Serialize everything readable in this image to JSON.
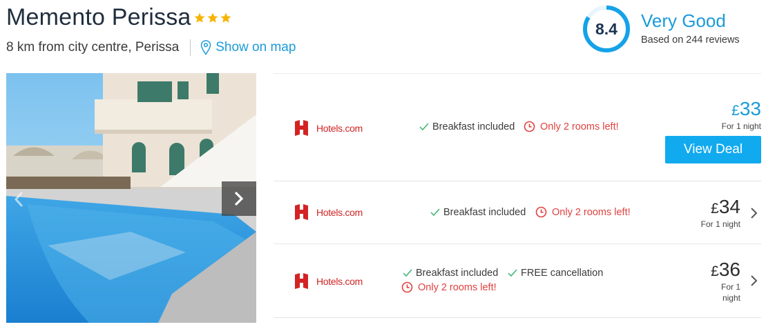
{
  "hotel": {
    "name": "Memento Perissa",
    "star_rating": 3,
    "distance": "8 km from city centre, Perissa",
    "map_link": "Show on map"
  },
  "rating": {
    "score": "8.4",
    "score_fraction": 0.84,
    "label": "Very Good",
    "reviews": "Based on 244 reviews"
  },
  "colors": {
    "accent": "#1a9bd9",
    "button": "#11aaef",
    "provider_red": "#d32323",
    "warning_red": "#e0413f",
    "check_green": "#3cb371"
  },
  "icons": [
    "star-icon",
    "map-pin-icon",
    "chevron-left-icon",
    "chevron-right-icon",
    "hotels-com-logo-icon",
    "checkmark-icon",
    "clock-icon"
  ],
  "deals": [
    {
      "provider": "Hotels.com",
      "features": [
        "Breakfast included"
      ],
      "urgency": "Only 2 rooms left!",
      "currency": "£",
      "price": "33",
      "per_night": "For 1 night",
      "cta": "View Deal"
    },
    {
      "provider": "Hotels.com",
      "features": [
        "Breakfast included"
      ],
      "urgency": "Only 2 rooms left!",
      "currency": "£",
      "price": "34",
      "per_night": "For 1 night"
    },
    {
      "provider": "Hotels.com",
      "features": [
        "Breakfast included",
        "FREE cancellation"
      ],
      "urgency": "Only 2 rooms left!",
      "currency": "£",
      "price": "36",
      "per_night_line1": "For 1",
      "per_night_line2": "night"
    }
  ]
}
